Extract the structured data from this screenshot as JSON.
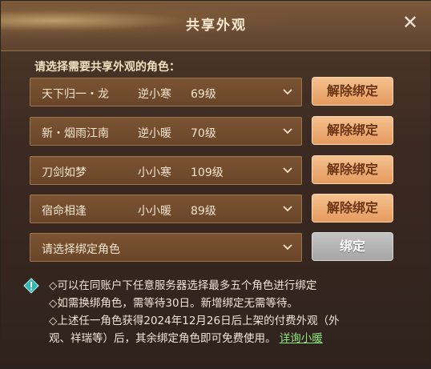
{
  "dialog": {
    "title": "共享外观",
    "close_label": "✕"
  },
  "prompt": "请选择需要共享外观的角色：",
  "rows": [
    {
      "name": "天下归一・龙",
      "role": "逆小寒",
      "level": "69级",
      "button": "解除绑定"
    },
    {
      "name": "新・烟雨江南",
      "role": "逆小暖",
      "level": "70级",
      "button": "解除绑定"
    },
    {
      "name": "刀剑如梦",
      "role": "小小寒",
      "level": "109级",
      "button": "解除绑定"
    },
    {
      "name": "宿命相逢",
      "role": "小小暖",
      "level": "89级",
      "button": "解除绑定"
    }
  ],
  "empty_row": {
    "placeholder": "请选择绑定角色",
    "button": "绑定"
  },
  "notes": {
    "line1": "◇可以在同账户下任意服务器选择最多五个角色进行绑定",
    "line2": "◇如需换绑角色，需等待30日。新增绑定无需等待。",
    "line3": "◇上述任一角色获得2024年12月26日后上架的付费外观（外",
    "line4_text": "观、祥瑞等）后，其余绑定角色即可免费使用。",
    "link": "详询小暖"
  },
  "colors": {
    "accent_button": "#e9a065",
    "disabled_button": "#b5b5b5",
    "link": "#8be77a"
  }
}
